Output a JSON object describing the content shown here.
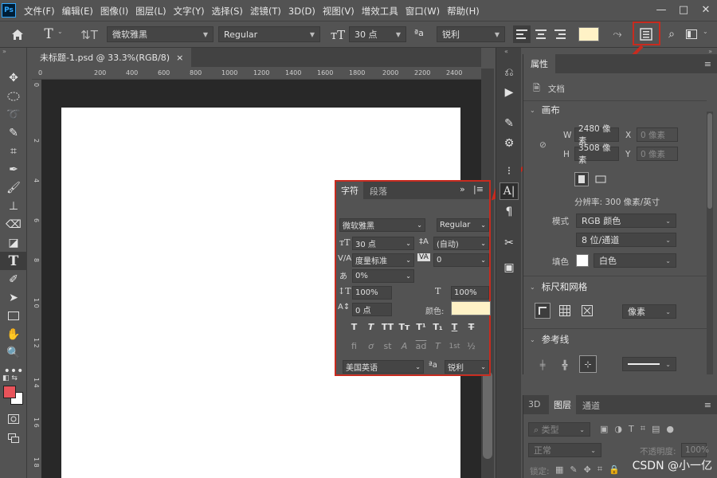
{
  "app": {
    "logo": "Ps"
  },
  "menubar": [
    "文件(F)",
    "编辑(E)",
    "图像(I)",
    "图层(L)",
    "文字(Y)",
    "选择(S)",
    "滤镜(T)",
    "3D(D)",
    "视图(V)",
    "增效工具",
    "窗口(W)",
    "帮助(H)"
  ],
  "window_controls": [
    "—",
    "□",
    "✕"
  ],
  "options": {
    "font_family": "微软雅黑",
    "font_style": "Regular",
    "font_size": "30 点",
    "aa_label": "ªa",
    "antialias": "锐利",
    "text_color": "#fff2c6"
  },
  "document": {
    "tab_title": "未标题-1.psd @ 33.3%(RGB/8)",
    "close": "×"
  },
  "ruler_top": [
    "0",
    "200",
    "400",
    "600",
    "800",
    "1000",
    "1200",
    "1400",
    "1600",
    "1800",
    "2000",
    "2200",
    "2400"
  ],
  "ruler_left": [
    "0",
    "2",
    "4",
    "6",
    "8",
    "1 0",
    "1 2",
    "1 4",
    "1 6",
    "1 8"
  ],
  "properties": {
    "tab": "属性",
    "doc_label": "文档",
    "canvas_section": "画布",
    "w_label": "W",
    "w_value": "2480 像素",
    "x_label": "X",
    "x_placeholder": "0 像素",
    "h_label": "H",
    "h_value": "3508 像素",
    "y_label": "Y",
    "y_placeholder": "0 像素",
    "resolution": "分辨率: 300 像素/英寸",
    "mode_label": "模式",
    "mode_value": "RGB 颜色",
    "depth_value": "8 位/通道",
    "fill_label": "填色",
    "fill_value": "白色",
    "rulers_section": "标尺和网格",
    "unit_value": "像素",
    "guides_section": "参考线"
  },
  "layers": {
    "tabs": [
      "3D",
      "图层",
      "通道"
    ],
    "filter_label": "类型",
    "blend_mode": "正常",
    "opacity_label": "不透明度:",
    "opacity_value": "100%",
    "lock_label": "锁定:"
  },
  "character": {
    "tabs": [
      "字符",
      "段落"
    ],
    "font_family": "微软雅黑",
    "font_style": "Regular",
    "font_size": "30 点",
    "leading": "(自动)",
    "kerning": "度量标准",
    "tracking": "0",
    "scale_pct": "0%",
    "vscale": "100%",
    "hscale": "100%",
    "baseline": "0 点",
    "color_label": "颜色:",
    "color": "#fff2c6",
    "language": "美国英语",
    "aa_label": "ªa",
    "antialias": "锐利",
    "glyphs_row1": [
      "T",
      "T",
      "TT",
      "Tт",
      "T¹",
      "T₁",
      "T",
      "T"
    ],
    "glyphs_row2": [
      "fi",
      "ơ",
      "st",
      "A",
      "ad",
      "T",
      "1st",
      "½"
    ]
  },
  "watermark": "CSDN @小一亿"
}
